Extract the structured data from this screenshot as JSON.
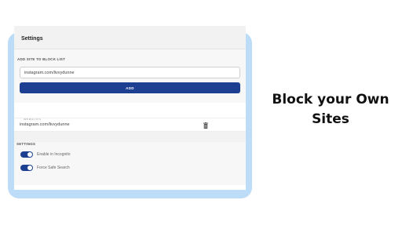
{
  "panel": {
    "title": "Settings"
  },
  "add_section": {
    "heading": "ADD SITE TO BLOCK LIST",
    "input_value": "instagram.com/livvydunne",
    "add_label": "ADD"
  },
  "websites": {
    "heading": "WEBSITES",
    "items": [
      {
        "label": "instagram.com/livvydunne",
        "icon": "trash-icon"
      }
    ]
  },
  "settings": {
    "heading": "SETTINGS",
    "toggles": [
      {
        "label": "Enable in Incognito",
        "on": true
      },
      {
        "label": "Force Safe Search",
        "on": true
      }
    ]
  },
  "headline": {
    "line1": "Block your Own",
    "line2": "Sites"
  },
  "colors": {
    "accent": "#1d3f91",
    "backdrop": "#bddcf8"
  }
}
